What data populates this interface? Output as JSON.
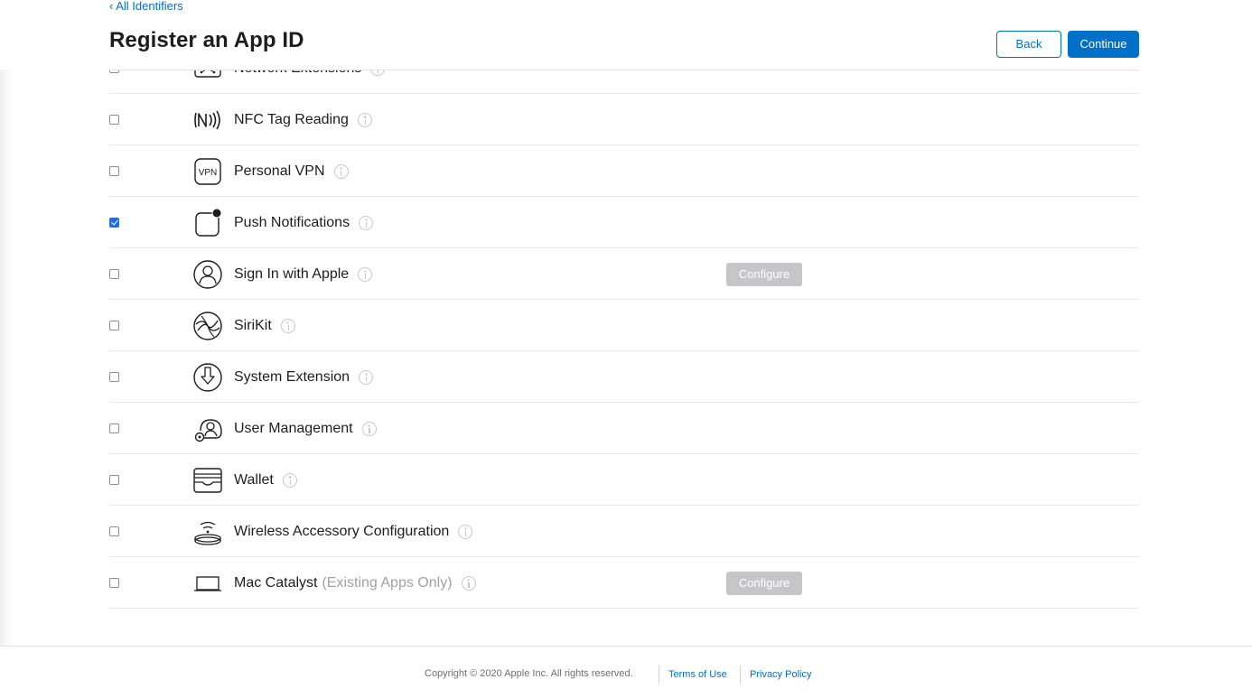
{
  "breadcrumb": {
    "label": "‹ All Identifiers"
  },
  "header": {
    "title": "Register an App ID",
    "back_label": "Back",
    "continue_label": "Continue"
  },
  "capabilities": [
    {
      "label": "Network Extensions",
      "icon": "network-extensions-icon",
      "checked": false
    },
    {
      "label": "NFC Tag Reading",
      "icon": "nfc-icon",
      "checked": false
    },
    {
      "label": "Personal VPN",
      "icon": "vpn-icon",
      "checked": false
    },
    {
      "label": "Push Notifications",
      "icon": "push-notifications-icon",
      "checked": true
    },
    {
      "label": "Sign In with Apple",
      "icon": "person-icon",
      "checked": false,
      "configure_label": "Configure"
    },
    {
      "label": "SiriKit",
      "icon": "siri-icon",
      "checked": false
    },
    {
      "label": "System Extension",
      "icon": "system-extension-icon",
      "checked": false
    },
    {
      "label": "User Management",
      "icon": "user-management-icon",
      "checked": false
    },
    {
      "label": "Wallet",
      "icon": "wallet-icon",
      "checked": false
    },
    {
      "label": "Wireless Accessory Configuration",
      "icon": "wireless-accessory-icon",
      "checked": false
    },
    {
      "label": "Mac Catalyst",
      "note": "(Existing Apps Only)",
      "icon": "laptop-icon",
      "checked": false,
      "configure_label": "Configure"
    }
  ],
  "footer": {
    "copyright": "Copyright © 2020 Apple Inc. All rights reserved.",
    "terms_label": "Terms of Use",
    "privacy_label": "Privacy Policy"
  },
  "colors": {
    "accent": "#0070c9",
    "checkbox_checked": "#1b6ff5",
    "configure_disabled": "#c6c6c8"
  }
}
